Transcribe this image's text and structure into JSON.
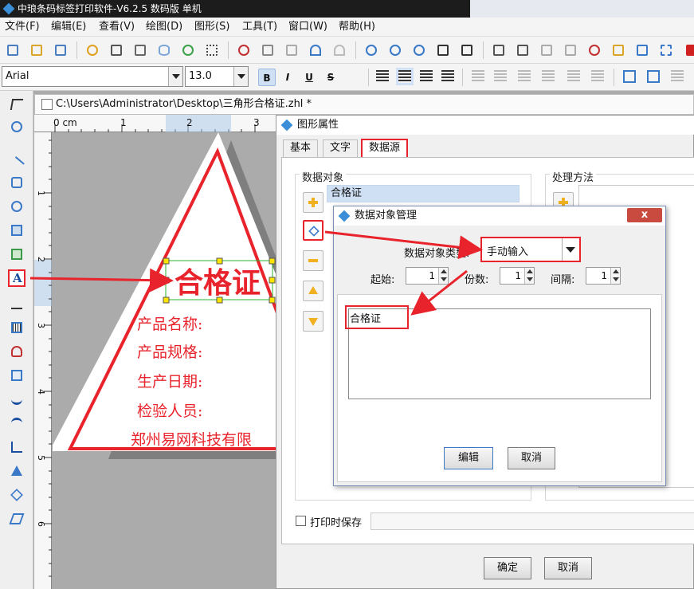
{
  "window": {
    "title": "中琅条码标签打印软件-V6.2.5 数码版 单机"
  },
  "menu": [
    "文件(F)",
    "编辑(E)",
    "查看(V)",
    "绘图(D)",
    "图形(S)",
    "工具(T)",
    "窗口(W)",
    "帮助(H)"
  ],
  "format_bar": {
    "font": "Arial",
    "size": "13.0",
    "bold": "B",
    "italic": "I",
    "underline": "U",
    "strike": "S"
  },
  "document": {
    "tab_title": "C:\\Users\\Administrator\\Desktop\\三角形合格证.zhl *",
    "ruler_unit": "0 cm",
    "ruler_h": [
      "1",
      "2",
      "3"
    ],
    "ruler_v": [
      "1",
      "2",
      "3",
      "4",
      "5",
      "6"
    ]
  },
  "label": {
    "title": "合格证",
    "lines": [
      "产品名称:",
      "产品规格:",
      "生产日期:",
      "检验人员:"
    ],
    "company": "郑州易网科技有限"
  },
  "colors": {
    "red": "#e8232b",
    "accent": "#3b8fd8"
  },
  "shape_props": {
    "title": "图形属性",
    "tabs": [
      "基本",
      "文字",
      "数据源"
    ],
    "data_object_label": "数据对象",
    "data_item": "合格证",
    "process_label": "处理方法",
    "save_on_print": "打印时保存",
    "ok": "确定",
    "cancel": "取消"
  },
  "data_mgr": {
    "title": "数据对象管理",
    "type_label": "数据对象类型:",
    "type_value": "手动输入",
    "start_label": "起始:",
    "start_value": "1",
    "copies_label": "份数:",
    "copies_value": "1",
    "interval_label": "间隔:",
    "interval_value": "1",
    "content": "合格证",
    "edit": "编辑",
    "cancel": "取消",
    "close": "x"
  }
}
